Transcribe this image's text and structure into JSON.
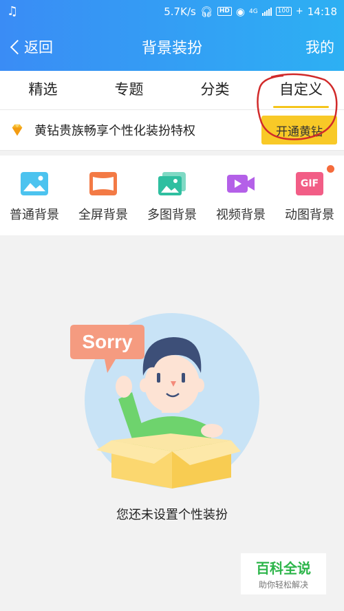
{
  "status_bar": {
    "speed": "5.7K/s",
    "hd": "HD",
    "network": "4G",
    "battery": "100",
    "time": "14:18"
  },
  "nav": {
    "back_label": "返回",
    "title": "背景装扮",
    "right_label": "我的"
  },
  "tabs": [
    {
      "label": "精选"
    },
    {
      "label": "专题"
    },
    {
      "label": "分类"
    },
    {
      "label": "自定义",
      "active": true
    }
  ],
  "promo": {
    "text": "黄钻贵族畅享个性化装扮特权",
    "button": "开通黄钻"
  },
  "bg_types": [
    {
      "label": "普通背景",
      "icon": "image-icon",
      "color": "#4cc3ef"
    },
    {
      "label": "全屏背景",
      "icon": "fullscreen-icon",
      "color": "#f37a45"
    },
    {
      "label": "多图背景",
      "icon": "multi-image-icon",
      "color": "#2fbfa0"
    },
    {
      "label": "视频背景",
      "icon": "video-icon",
      "color": "#b460e8"
    },
    {
      "label": "动图背景",
      "icon": "gif-icon",
      "color": "#f25d86",
      "badge_text": "GIF",
      "has_dot": true
    }
  ],
  "empty_state": {
    "bubble": "Sorry",
    "message": "您还未设置个性装扮"
  },
  "watermark": {
    "title": "百科全说",
    "subtitle": "助你轻松解决"
  },
  "colors": {
    "accent": "#f5c51b",
    "header_gradient_start": "#3a8cf5",
    "header_gradient_end": "#2db0f3",
    "annotation": "#d12a2a"
  }
}
